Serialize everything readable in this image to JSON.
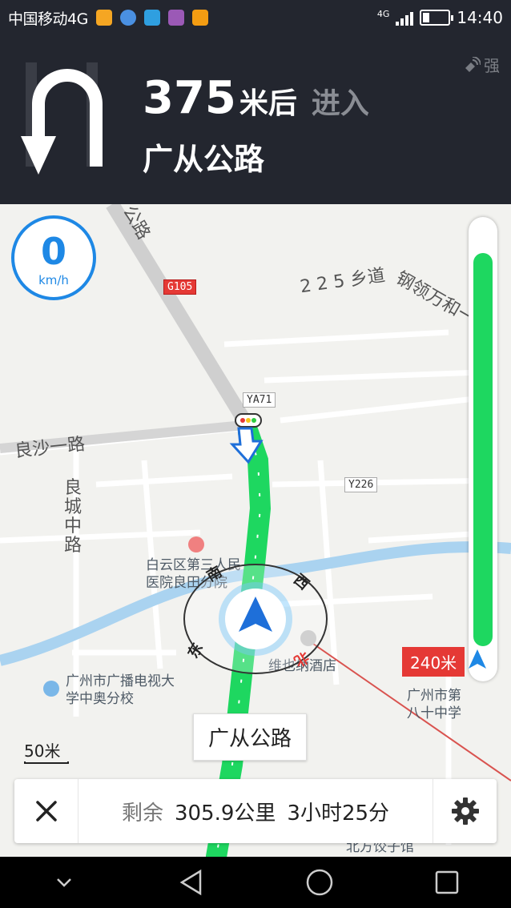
{
  "status_bar": {
    "carrier": "中国移动4G",
    "network": "4G",
    "time": "14:40"
  },
  "guidance": {
    "distance_value": "375",
    "distance_unit": "米后",
    "action": "进入",
    "road": "广从公路",
    "turn_icon": "u-turn-icon",
    "gps_strength": "强"
  },
  "map": {
    "speed_value": "0",
    "speed_unit": "km/h",
    "labels": {
      "road_top": "公路",
      "township_road": "2 2 5 乡道",
      "road_right": "钢领万和一",
      "liangsha_road": "良沙一路",
      "liangcheng_road": "良城中路",
      "hospital": "白云区第三人民医院良田分院",
      "hotel": "维也纳酒店",
      "school_left": "广州市广播电视大学中奥分校",
      "school_right": "广州市第八十中学",
      "bottom_partial": "北方饺子馆"
    },
    "shields": {
      "g105": "G105",
      "ya71": "YA71",
      "y226": "Y226"
    },
    "compass": {
      "north": "北",
      "south": "南",
      "east": "东",
      "west": "西"
    },
    "current_road": "广从公路",
    "scale": "50米",
    "next_distance_tag": "240米",
    "route_progress_ratio": 0.93
  },
  "bottom_panel": {
    "remaining_label": "剩余",
    "remaining_distance": "305.9公里",
    "remaining_time": "3小时25分"
  },
  "colors": {
    "header_bg": "#23262f",
    "route_green": "#1ed760",
    "accent_blue": "#1e88e5",
    "alert_red": "#e53935"
  }
}
